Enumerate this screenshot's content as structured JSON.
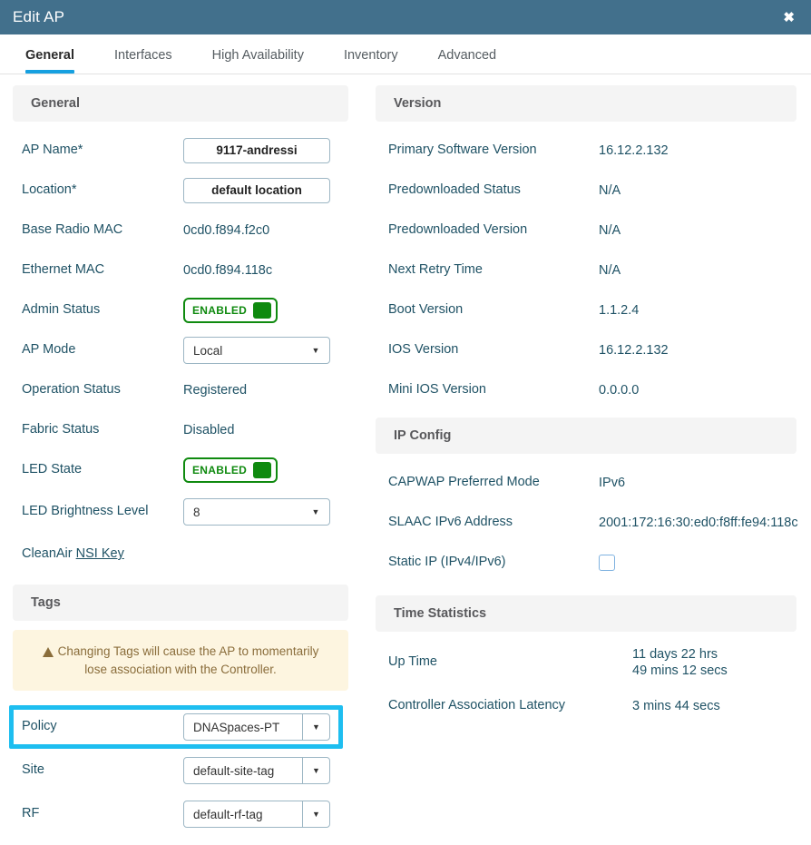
{
  "window": {
    "title": "Edit AP",
    "close_icon": "close-icon",
    "close_glyph": "✖"
  },
  "tabs": [
    {
      "label": "General",
      "active": true
    },
    {
      "label": "Interfaces",
      "active": false
    },
    {
      "label": "High Availability",
      "active": false
    },
    {
      "label": "Inventory",
      "active": false
    },
    {
      "label": "Advanced",
      "active": false
    }
  ],
  "general": {
    "section_title": "General",
    "ap_name": {
      "label": "AP Name*",
      "value": "9117-andressi"
    },
    "location": {
      "label": "Location*",
      "value": "default location"
    },
    "base_radio_mac": {
      "label": "Base Radio MAC",
      "value": "0cd0.f894.f2c0"
    },
    "ethernet_mac": {
      "label": "Ethernet MAC",
      "value": "0cd0.f894.118c"
    },
    "admin_status": {
      "label": "Admin Status",
      "value": "ENABLED"
    },
    "ap_mode": {
      "label": "AP Mode",
      "value": "Local"
    },
    "operation_status": {
      "label": "Operation Status",
      "value": "Registered"
    },
    "fabric_status": {
      "label": "Fabric Status",
      "value": "Disabled"
    },
    "led_state": {
      "label": "LED State",
      "value": "ENABLED"
    },
    "led_brightness": {
      "label": "LED Brightness Level",
      "value": "8"
    },
    "cleanair": {
      "prefix": "CleanAir",
      "link": "NSI Key"
    }
  },
  "tags": {
    "section_title": "Tags",
    "warning": "Changing Tags will cause the AP to momentarily lose association with the Controller.",
    "warning_icon": "warning-triangle-icon",
    "policy": {
      "label": "Policy",
      "value": "DNASpaces-PT"
    },
    "site": {
      "label": "Site",
      "value": "default-site-tag"
    },
    "rf": {
      "label": "RF",
      "value": "default-rf-tag"
    }
  },
  "version": {
    "section_title": "Version",
    "primary_software": {
      "label": "Primary Software Version",
      "value": "16.12.2.132"
    },
    "predownloaded_status": {
      "label": "Predownloaded Status",
      "value": "N/A"
    },
    "predownloaded_version": {
      "label": "Predownloaded Version",
      "value": "N/A"
    },
    "next_retry_time": {
      "label": "Next Retry Time",
      "value": "N/A"
    },
    "boot_version": {
      "label": "Boot Version",
      "value": "1.1.2.4"
    },
    "ios_version": {
      "label": "IOS Version",
      "value": "16.12.2.132"
    },
    "mini_ios_version": {
      "label": "Mini IOS Version",
      "value": "0.0.0.0"
    }
  },
  "ip_config": {
    "section_title": "IP Config",
    "capwap_mode": {
      "label": "CAPWAP Preferred Mode",
      "value": "IPv6"
    },
    "slaac_ipv6": {
      "label": "SLAAC IPv6 Address",
      "value": "2001:172:16:30:ed0:f8ff:fe94:118c"
    },
    "static_ip": {
      "label": "Static IP (IPv4/IPv6)",
      "checked": false
    }
  },
  "time_statistics": {
    "section_title": "Time Statistics",
    "up_time": {
      "label": "Up Time",
      "line1": "11 days 22 hrs",
      "line2": "49 mins 12 secs"
    },
    "controller_latency": {
      "label": "Controller Association Latency",
      "value": "3 mins 44 secs"
    }
  },
  "colors": {
    "titlebar": "#42708c",
    "tab_active_underline": "#16a0e0",
    "label_text": "#1f5265",
    "section_header_bg": "#f4f4f4",
    "toggle_green": "#0f8a0f",
    "warning_bg": "#fdf5e0",
    "warning_text": "#8a6d3b",
    "highlight_cyan": "#1ebef0"
  },
  "icons": {
    "dropdown_arrow": "▼"
  }
}
